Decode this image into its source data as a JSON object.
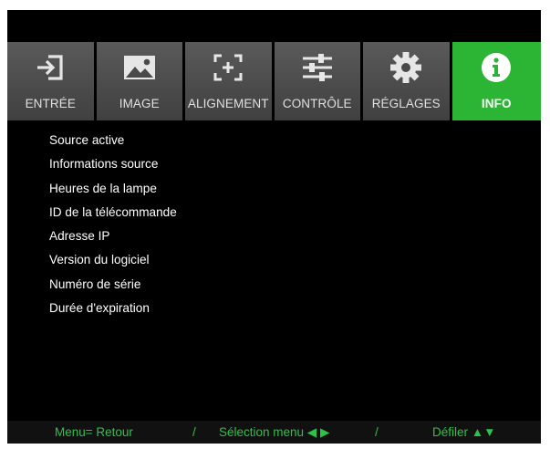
{
  "tabs": [
    {
      "label": "ENTRÉE",
      "icon": "input-icon"
    },
    {
      "label": "IMAGE",
      "icon": "image-icon"
    },
    {
      "label": "ALIGNEMENT",
      "icon": "alignment-icon"
    },
    {
      "label": "CONTRÔLE",
      "icon": "sliders-icon"
    },
    {
      "label": "RÉGLAGES",
      "icon": "gear-icon"
    },
    {
      "label": "INFO",
      "icon": "info-icon",
      "active": true
    }
  ],
  "menu": {
    "items": [
      "Source active",
      "Informations source",
      "Heures de la lampe",
      "ID de la télécommande",
      "Adresse IP",
      "Version du logiciel",
      "Numéro de série",
      "Durée d'expiration"
    ]
  },
  "footer": {
    "back": "Menu= Retour",
    "sep1": "/",
    "select": "Sélection menu ◀ ▶",
    "sep2": "/",
    "scroll": "Défiler ▲▼"
  },
  "colors": {
    "accent": "#2cb534",
    "footer_text": "#2ec24a",
    "tab_bg": "#4a4a4a",
    "background": "#000000"
  }
}
